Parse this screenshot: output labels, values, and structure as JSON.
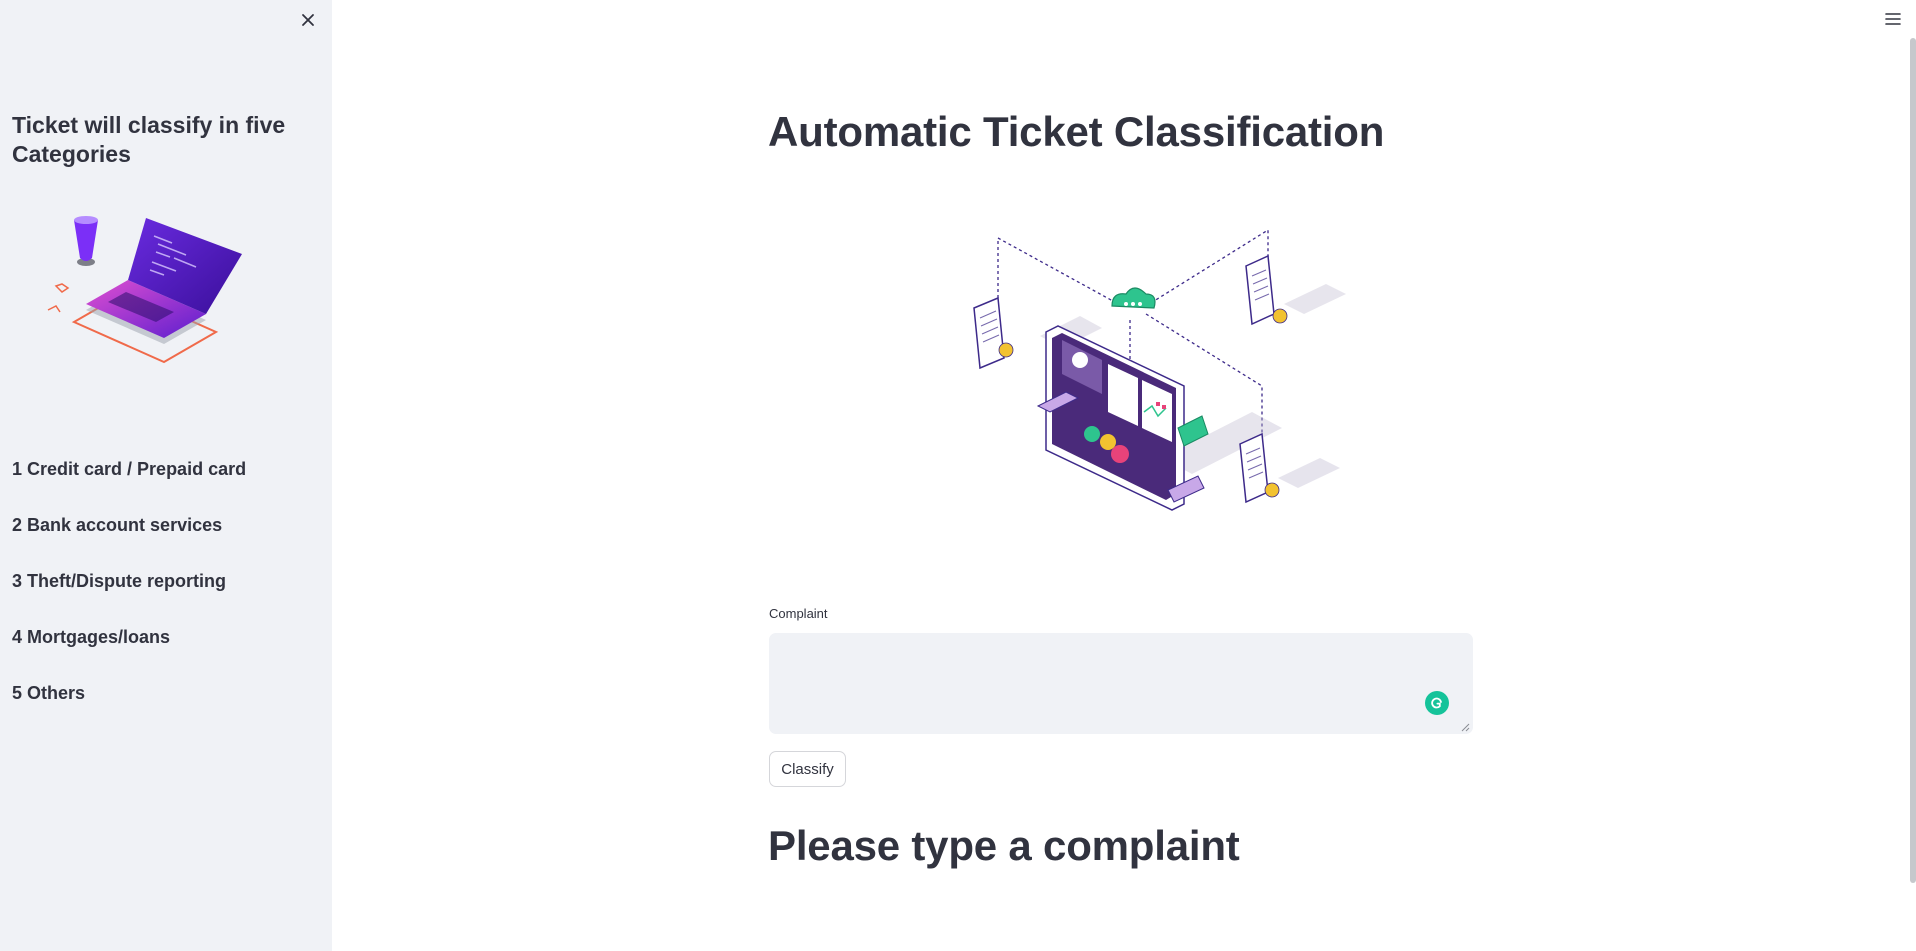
{
  "sidebar": {
    "title": "Ticket will classify in five Categories",
    "categories": [
      "1 Credit card / Prepaid card",
      "2 Bank account services",
      "3 Theft/Dispute reporting",
      "4 Mortgages/loans",
      "5 Others"
    ],
    "close_icon": "close-icon",
    "illustration": "laptop-illustration"
  },
  "header": {
    "menu_icon": "hamburger-menu-icon"
  },
  "main": {
    "title": "Automatic Ticket Classification",
    "illustration": "network-dashboard-illustration",
    "complaint": {
      "label": "Complaint",
      "value": "",
      "placeholder": ""
    },
    "classify_label": "Classify",
    "result_heading": "Please type a complaint"
  },
  "colors": {
    "sidebar_bg": "#f0f2f6",
    "text": "#31333f",
    "accent_purple": "#7b2ff7",
    "accent_green": "#15c39a"
  }
}
